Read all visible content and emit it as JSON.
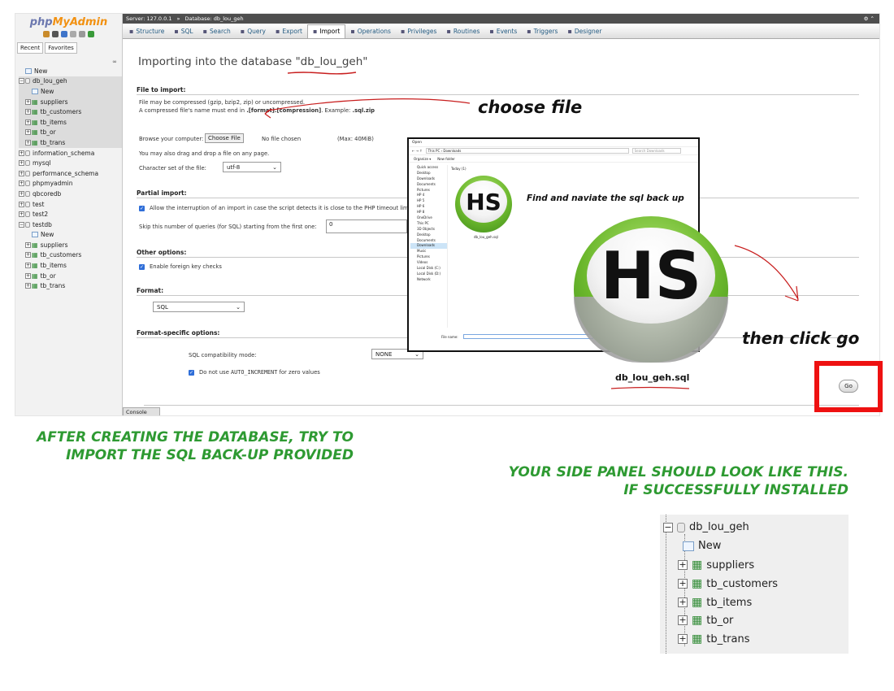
{
  "sidebar": {
    "logo_php": "php",
    "logo_myadmin": "MyAdmin",
    "tabs": [
      "Recent",
      "Favorites"
    ],
    "tree": [
      {
        "label": "New",
        "kind": "new",
        "indent": 1
      },
      {
        "label": "db_lou_geh",
        "kind": "db",
        "indent": 0,
        "expanded": true,
        "highlight": true
      },
      {
        "label": "New",
        "kind": "new",
        "indent": 2,
        "highlight": true
      },
      {
        "label": "suppliers",
        "kind": "table",
        "indent": 1,
        "highlight": true
      },
      {
        "label": "tb_customers",
        "kind": "table",
        "indent": 1,
        "highlight": true
      },
      {
        "label": "tb_items",
        "kind": "table",
        "indent": 1,
        "highlight": true
      },
      {
        "label": "tb_or",
        "kind": "table",
        "indent": 1,
        "highlight": true
      },
      {
        "label": "tb_trans",
        "kind": "table",
        "indent": 1,
        "highlight": true
      },
      {
        "label": "information_schema",
        "kind": "db",
        "indent": 0
      },
      {
        "label": "mysql",
        "kind": "db",
        "indent": 0
      },
      {
        "label": "performance_schema",
        "kind": "db",
        "indent": 0
      },
      {
        "label": "phpmyadmin",
        "kind": "db",
        "indent": 0
      },
      {
        "label": "qbcoredb",
        "kind": "db",
        "indent": 0
      },
      {
        "label": "test",
        "kind": "db",
        "indent": 0
      },
      {
        "label": "test2",
        "kind": "db",
        "indent": 0
      },
      {
        "label": "testdb",
        "kind": "db",
        "indent": 0,
        "expanded": true
      },
      {
        "label": "New",
        "kind": "new",
        "indent": 2
      },
      {
        "label": "suppliers",
        "kind": "table",
        "indent": 1
      },
      {
        "label": "tb_customers",
        "kind": "table",
        "indent": 1
      },
      {
        "label": "tb_items",
        "kind": "table",
        "indent": 1
      },
      {
        "label": "tb_or",
        "kind": "table",
        "indent": 1
      },
      {
        "label": "tb_trans",
        "kind": "table",
        "indent": 1
      }
    ]
  },
  "topbar": {
    "server": "Server: 127.0.0.1",
    "sep": "»",
    "database": "Database: db_lou_geh"
  },
  "tabs": [
    {
      "label": "Structure",
      "icon": "structure-icon"
    },
    {
      "label": "SQL",
      "icon": "sql-icon"
    },
    {
      "label": "Search",
      "icon": "search-icon"
    },
    {
      "label": "Query",
      "icon": "query-icon"
    },
    {
      "label": "Export",
      "icon": "export-icon"
    },
    {
      "label": "Import",
      "icon": "import-icon",
      "active": true
    },
    {
      "label": "Operations",
      "icon": "wrench-icon"
    },
    {
      "label": "Privileges",
      "icon": "privileges-icon"
    },
    {
      "label": "Routines",
      "icon": "routines-icon"
    },
    {
      "label": "Events",
      "icon": "clock-icon"
    },
    {
      "label": "Triggers",
      "icon": "triggers-icon"
    },
    {
      "label": "Designer",
      "icon": "designer-icon"
    }
  ],
  "import": {
    "title_prefix": "Importing into the database ",
    "title_db": "\"db_lou_geh\"",
    "file_section": "File to import:",
    "compress_note": "File may be compressed (gzip, bzip2, zip) or uncompressed.",
    "compress_name_pre": "A compressed file's name must end in ",
    "compress_name_fmt": ".[format].[compression]",
    "compress_name_ex": ". Example: ",
    "compress_name_zip": ".sql.zip",
    "browse_label": "Browse your computer:",
    "choose_file": "Choose File",
    "no_file": "No file chosen",
    "max": "(Max: 40MiB)",
    "drag_note": "You may also drag and drop a file on any page.",
    "charset_label": "Character set of the file:",
    "charset_value": "utf-8",
    "partial_section": "Partial import:",
    "allow_interrupt": "Allow the interruption of an import in case the script detects it is close to the PHP timeout limit. (Th",
    "skip_label": "Skip this number of queries (for SQL) starting from the first one:",
    "skip_value": "0",
    "other_section": "Other options:",
    "fk_checks": "Enable foreign key checks",
    "format_section": "Format:",
    "format_value": "SQL",
    "specific_section": "Format-specific options:",
    "compat_label": "SQL compatibility mode:",
    "compat_value": "NONE",
    "auto_inc_pre": "Do not use ",
    "auto_inc_code": "AUTO_INCREMENT",
    "auto_inc_post": " for zero values",
    "go": "Go",
    "console": "Console"
  },
  "dialog": {
    "title": "Open",
    "address": "This PC  ›  Downloads",
    "search": "Search Downloads",
    "organize": "Organize ▾",
    "new_folder": "New folder",
    "today": "Today (1)",
    "nav": [
      "Quick access",
      "Desktop",
      "Downloads",
      "Documents",
      "Pictures",
      "HP 4",
      "HP 5",
      "HP 6",
      "HP 8",
      "OneDrive",
      "This PC",
      "3D Objects",
      "Desktop",
      "Documents",
      "Downloads",
      "Music",
      "Pictures",
      "Videos",
      "Local Disk (C:)",
      "Local Disk (D:)",
      "Network"
    ],
    "file_caption": "db_lou_geh.sql",
    "file_name_label": "File name:",
    "hs_text": "HS"
  },
  "annotations": {
    "choose_file": "choose file",
    "find": "Find and naviate the sql back up",
    "then_click_go": "then click go",
    "sql_file": "db_lou_geh.sql",
    "after_line1": "AFTER CREATING THE DATABASE, TRY TO",
    "after_line2": "IMPORT THE SQL BACK-UP PROVIDED",
    "panel_line1": "YOUR SIDE PANEL SHOULD LOOK LIKE THIS.",
    "panel_line2": "IF SUCCESSFULLY INSTALLED"
  },
  "zoom_panel": [
    {
      "label": "db_lou_geh",
      "kind": "db"
    },
    {
      "label": "New",
      "kind": "new"
    },
    {
      "label": "suppliers",
      "kind": "table"
    },
    {
      "label": "tb_customers",
      "kind": "table"
    },
    {
      "label": "tb_items",
      "kind": "table"
    },
    {
      "label": "tb_or",
      "kind": "table"
    },
    {
      "label": "tb_trans",
      "kind": "table"
    }
  ],
  "colors": {
    "accent_green": "#2e9a32",
    "alert_red": "#ee1111",
    "pma_blue": "#235a81",
    "hs_green": "#6cb82d"
  }
}
